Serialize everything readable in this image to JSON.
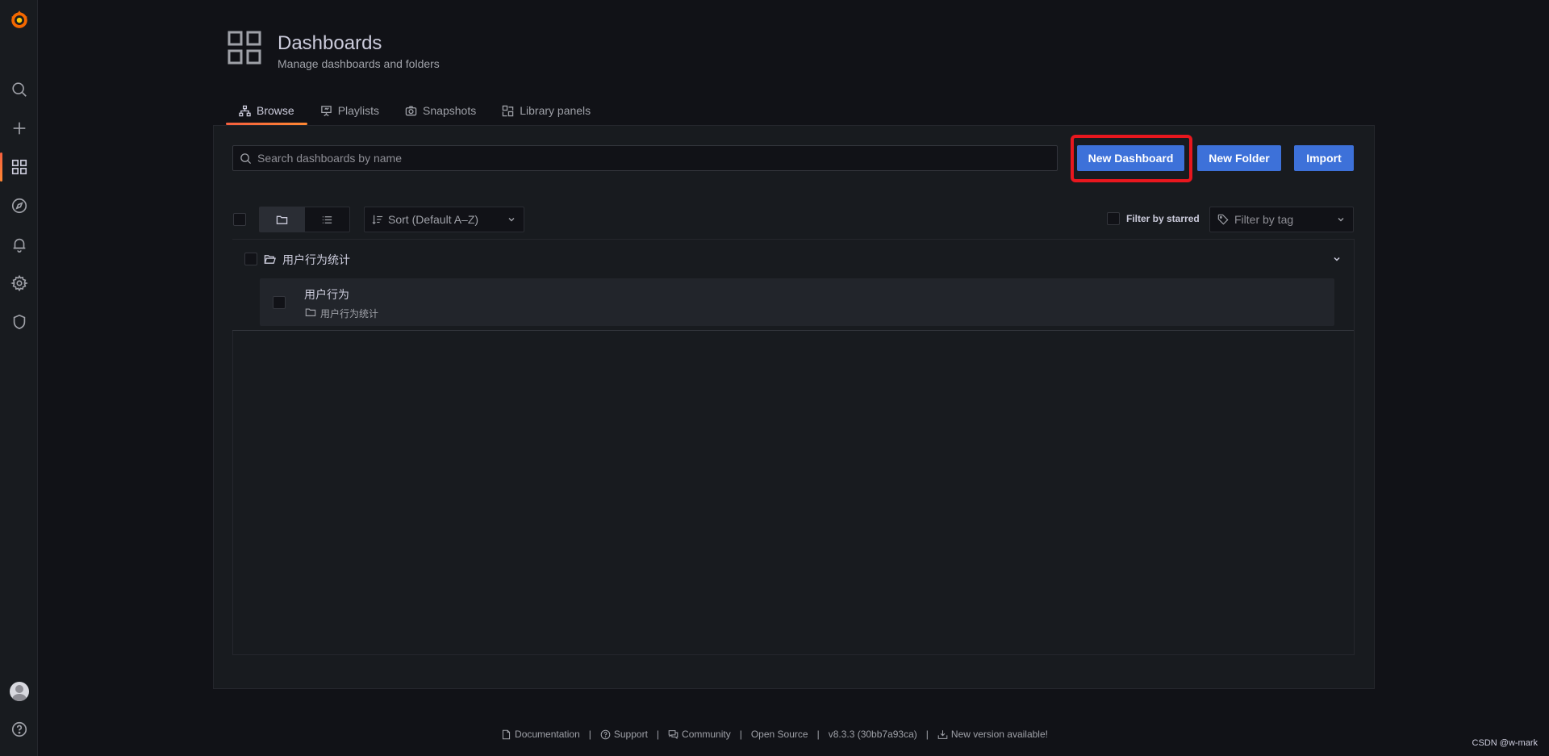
{
  "page": {
    "title": "Dashboards",
    "subtitle": "Manage dashboards and folders"
  },
  "tabs": [
    {
      "label": "Browse",
      "icon": "sitemap-icon",
      "active": true
    },
    {
      "label": "Playlists",
      "icon": "presentation-icon",
      "active": false
    },
    {
      "label": "Snapshots",
      "icon": "camera-icon",
      "active": false
    },
    {
      "label": "Library panels",
      "icon": "library-panel-icon",
      "active": false
    }
  ],
  "search": {
    "placeholder": "Search dashboards by name",
    "value": ""
  },
  "actions": {
    "new_dashboard": "New Dashboard",
    "new_folder": "New Folder",
    "import": "Import"
  },
  "controls": {
    "sort_label": "Sort (Default A–Z)",
    "filter_starred": "Filter by starred",
    "filter_tag_placeholder": "Filter by tag"
  },
  "folders": [
    {
      "name": "用户行为统计",
      "dashboards": [
        {
          "title": "用户行为",
          "folder": "用户行为统计"
        }
      ]
    }
  ],
  "footer": {
    "documentation": "Documentation",
    "support": "Support",
    "community": "Community",
    "open_source": "Open Source",
    "version": "v8.3.3 (30bb7a93ca)",
    "new_version": "New version available!"
  },
  "watermark": "CSDN @w-mark",
  "colors": {
    "background": "#111217",
    "panel": "#181b1f",
    "primary_button": "#3d71d9",
    "active_accent": "#f55f3e",
    "highlight_box": "#e8171e"
  }
}
